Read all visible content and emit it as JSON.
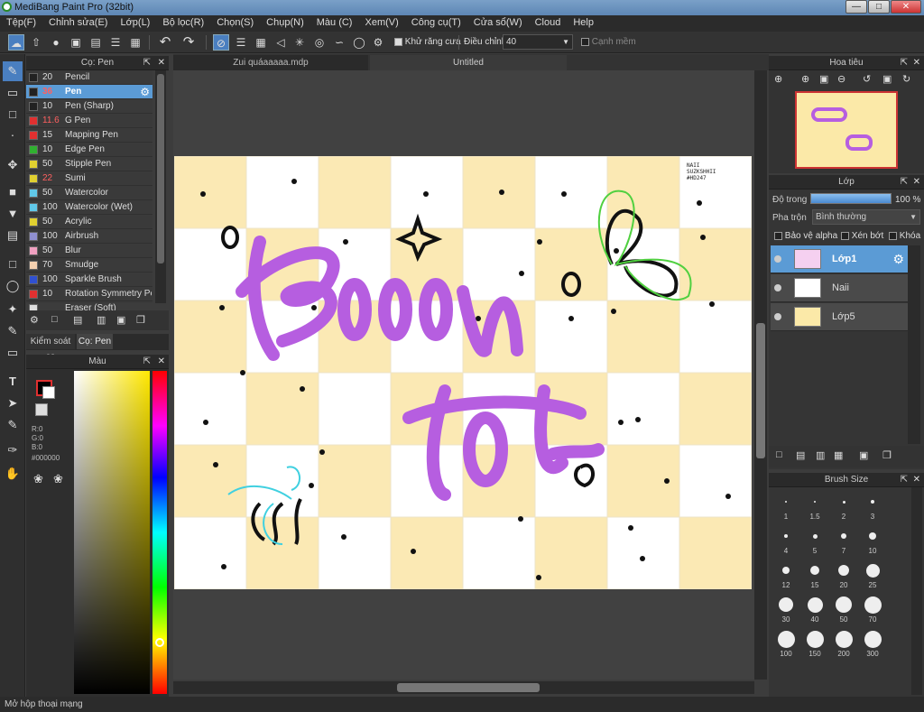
{
  "window": {
    "title": "MediBang Paint Pro (32bit)"
  },
  "menu": [
    "Tệp(F)",
    "Chỉnh sửa(E)",
    "Lớp(L)",
    "Bộ lọc(R)",
    "Chọn(S)",
    "Chụp(N)",
    "Màu (C)",
    "Xem(V)",
    "Công cụ(T)",
    "Cửa sổ(W)",
    "Cloud",
    "Help"
  ],
  "toolbar": {
    "antialias_label": "Khử răng cưa",
    "adjust_label": "Điều chỉnh",
    "adjust_value": "40",
    "soft_edge_label": "Cạnh mềm"
  },
  "brush_panel": {
    "title": "Cọ: Pen",
    "items": [
      {
        "size": "20",
        "name": "Pencil",
        "color": "#222222"
      },
      {
        "size": "36",
        "name": "Pen",
        "color": "#222222"
      },
      {
        "size": "10",
        "name": "Pen (Sharp)",
        "color": "#222222"
      },
      {
        "size": "11.6",
        "name": "G Pen",
        "color": "#e03030"
      },
      {
        "size": "15",
        "name": "Mapping Pen",
        "color": "#e03030"
      },
      {
        "size": "10",
        "name": "Edge Pen",
        "color": "#30b030"
      },
      {
        "size": "50",
        "name": "Stipple Pen",
        "color": "#e0d030"
      },
      {
        "size": "22",
        "name": "Sumi",
        "color": "#e0d030"
      },
      {
        "size": "50",
        "name": "Watercolor",
        "color": "#60c8e8"
      },
      {
        "size": "100",
        "name": "Watercolor (Wet)",
        "color": "#60c8e8"
      },
      {
        "size": "50",
        "name": "Acrylic",
        "color": "#e0d030"
      },
      {
        "size": "100",
        "name": "Airbrush",
        "color": "#9090d0"
      },
      {
        "size": "50",
        "name": "Blur",
        "color": "#f0a0c0"
      },
      {
        "size": "70",
        "name": "Smudge",
        "color": "#f4d0b0"
      },
      {
        "size": "100",
        "name": "Sparkle Brush",
        "color": "#3050d0"
      },
      {
        "size": "10",
        "name": "Rotation Symmetry Pe",
        "color": "#e03030"
      },
      {
        "size": "",
        "name": "Eraser (Soft)",
        "color": "#dddddd"
      }
    ],
    "tabs": [
      "Kiểm soát cọ",
      "Cọ: Pen"
    ]
  },
  "color_panel": {
    "title": "Màu",
    "r": "R:0",
    "g": "G:0",
    "b": "B:0",
    "hex": "#000000"
  },
  "doc_tabs": [
    "Zui quáaaaaa.mdp",
    "Untitled"
  ],
  "canvas": {
    "signature_lines": [
      "NAII",
      "SUZKSHHII",
      "#HD247"
    ]
  },
  "navigator": {
    "title": "Hoa tiêu"
  },
  "layer_panel": {
    "title": "Lớp",
    "opacity_label": "Độ trong",
    "opacity_value": "100 %",
    "blend_label": "Pha trộn",
    "blend_value": "Bình thường",
    "protect_alpha": "Bảo vệ alpha",
    "clipping": "Xén bớt",
    "lock": "Khóa",
    "layers": [
      {
        "name": "Lớp1",
        "selected": true
      },
      {
        "name": "Naii",
        "selected": false
      },
      {
        "name": "Lớp5",
        "selected": false
      }
    ]
  },
  "brush_size_panel": {
    "title": "Brush Size",
    "sizes": [
      "1",
      "1.5",
      "2",
      "3",
      "4",
      "5",
      "7",
      "10",
      "12",
      "15",
      "20",
      "25",
      "30",
      "40",
      "50",
      "70",
      "100",
      "150",
      "200",
      "300"
    ]
  },
  "status": "Mở hộp thoại mạng"
}
